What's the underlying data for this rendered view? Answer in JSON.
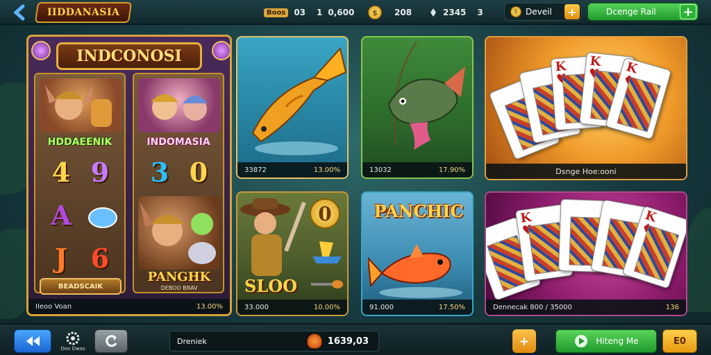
{
  "header": {
    "logo_text": "IIDDANASIA",
    "stat_tag": "Boos",
    "stat_a": "03",
    "stat_b": "1",
    "stat_c": "0,600",
    "coin_value": "208",
    "gems_value": "2345",
    "gems_suffix": "3",
    "deposit_label": "Deveil",
    "cta_label": "Dcenge Rail"
  },
  "tiles": {
    "slot": {
      "banner": "INDCONOSI",
      "reel_left_name": "HDDAEENIK",
      "reel_right_name": "INDOMASIA",
      "symbols": [
        "4",
        "9",
        "3",
        "0",
        "A",
        "J",
        "6"
      ],
      "reel_button": "BEADSCAIK",
      "reel_title": "PANGHK",
      "reel_sub": "DEBOO BRAV",
      "label_left": "IIeoo Voan",
      "label_right": "13.00%"
    },
    "fish1": {
      "label_left": "33872",
      "label_right": "13.00%"
    },
    "fish2": {
      "label_left": "13032",
      "label_right": "17.90%"
    },
    "card1": {
      "label": "Dsnge Hoe:ooni"
    },
    "fish3": {
      "title": "SLOO",
      "badge": "0",
      "label_left": "33.000",
      "label_right": "10.00%"
    },
    "fish4": {
      "title": "PANCHIC",
      "label_left": "91.000",
      "label_right": "17.50%"
    },
    "card2": {
      "label_left": "Dennecak 800 / 35000",
      "label_right": "136"
    }
  },
  "footer": {
    "settings_label": "Deo Dwas",
    "search_text": "Dreniek",
    "balance": "1639,03",
    "plus": "+",
    "green_label": "Hiteng Me",
    "yellow_label": "E0"
  },
  "colors": {
    "accent_gold": "#d8a23a",
    "accent_green": "#1f9a2c",
    "accent_blue": "#1a64d0"
  }
}
